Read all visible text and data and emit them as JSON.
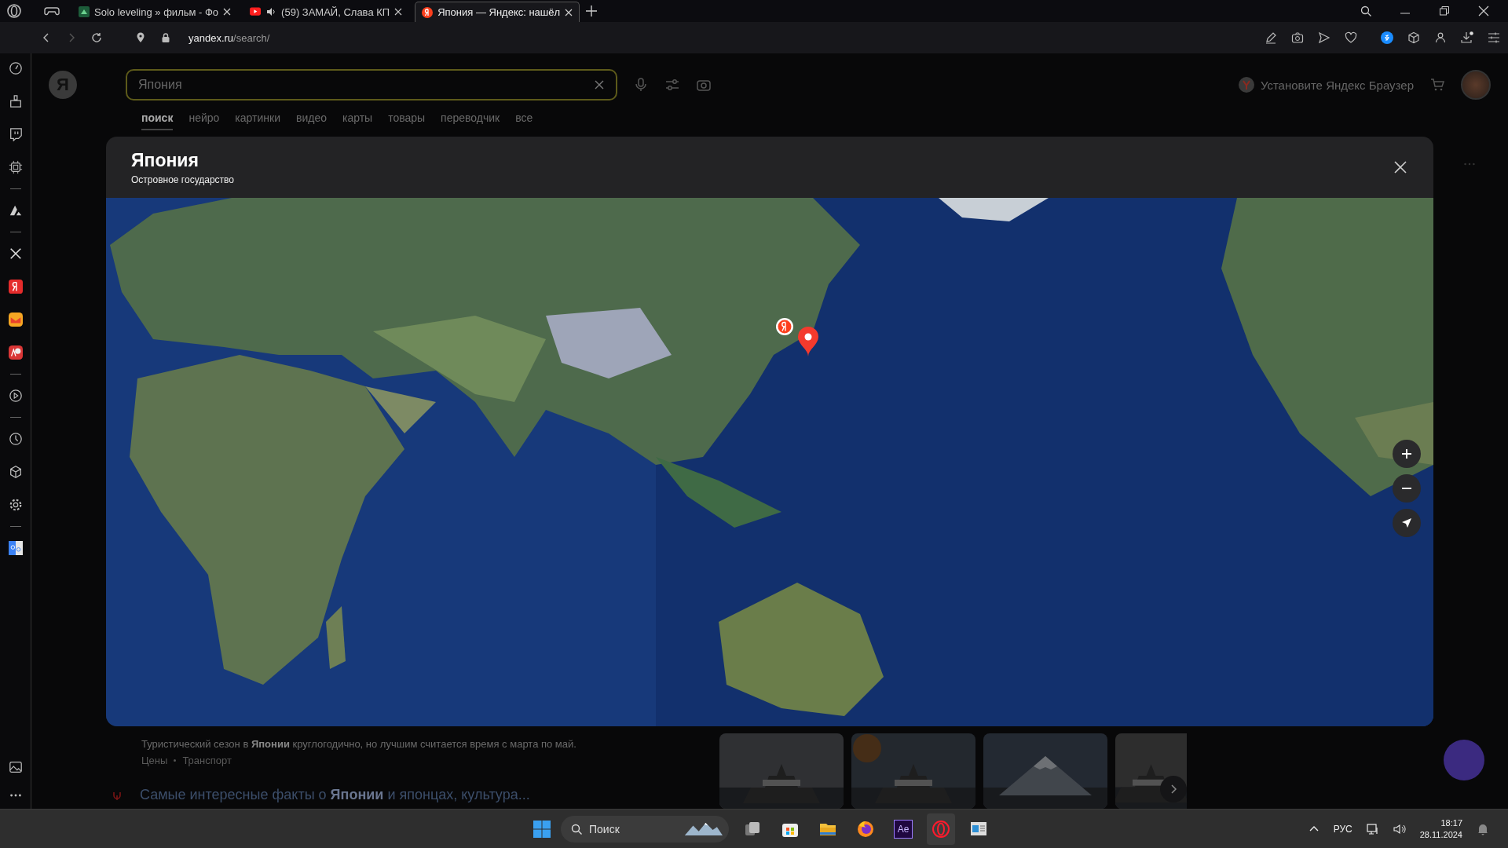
{
  "browser": {
    "tabs": [
      {
        "kind": "film",
        "title": "Solo leveling » фильм - Фо",
        "audio": false,
        "selected": false
      },
      {
        "kind": "video",
        "title": "(59) ЗАМАЙ, Слава КП",
        "audio": true,
        "selected": false
      },
      {
        "kind": "yandex",
        "title": "Япония — Яндекс: нашёл",
        "audio": false,
        "selected": true
      }
    ],
    "url_host": "yandex.ru",
    "url_path": "/search/"
  },
  "header": {
    "logo": "Я",
    "search": {
      "value": "Япония"
    },
    "promo": "Установите Яндекс Браузер"
  },
  "nav": [
    {
      "label": "поиск",
      "selected": true
    },
    {
      "label": "нейро",
      "selected": false
    },
    {
      "label": "картинки",
      "selected": false
    },
    {
      "label": "видео",
      "selected": false
    },
    {
      "label": "карты",
      "selected": false
    },
    {
      "label": "товары",
      "selected": false
    },
    {
      "label": "переводчик",
      "selected": false
    },
    {
      "label": "все",
      "selected": false
    }
  ],
  "modal": {
    "title": "Япония",
    "subtitle": "Островное государство",
    "map": {
      "kind": "picture"
    }
  },
  "results": {
    "snippet": "Туристический сезон в **Японии** круглогодично, но лучшим считается время с марта по май.",
    "links": [
      "Цены",
      "Транспорт"
    ],
    "next_title": "Самые интересные факты о **Японии** и японцах, культура...",
    "images": [
      {
        "kind": "picture"
      },
      {
        "kind": "picture"
      },
      {
        "kind": "picture"
      },
      {
        "kind": "picture"
      }
    ]
  },
  "taskbar": {
    "search_placeholder": "Поиск",
    "apps": [
      {
        "kind": "files",
        "selected": false
      },
      {
        "kind": "store",
        "selected": false
      },
      {
        "kind": "folder",
        "selected": false
      },
      {
        "kind": "firefox",
        "selected": false
      },
      {
        "kind": "ae",
        "label": "Ae",
        "selected": false
      },
      {
        "kind": "opera",
        "selected": true
      },
      {
        "kind": "window",
        "selected": false
      }
    ],
    "lang": "РУС",
    "time": "18:17",
    "date": "28.11.2024"
  }
}
